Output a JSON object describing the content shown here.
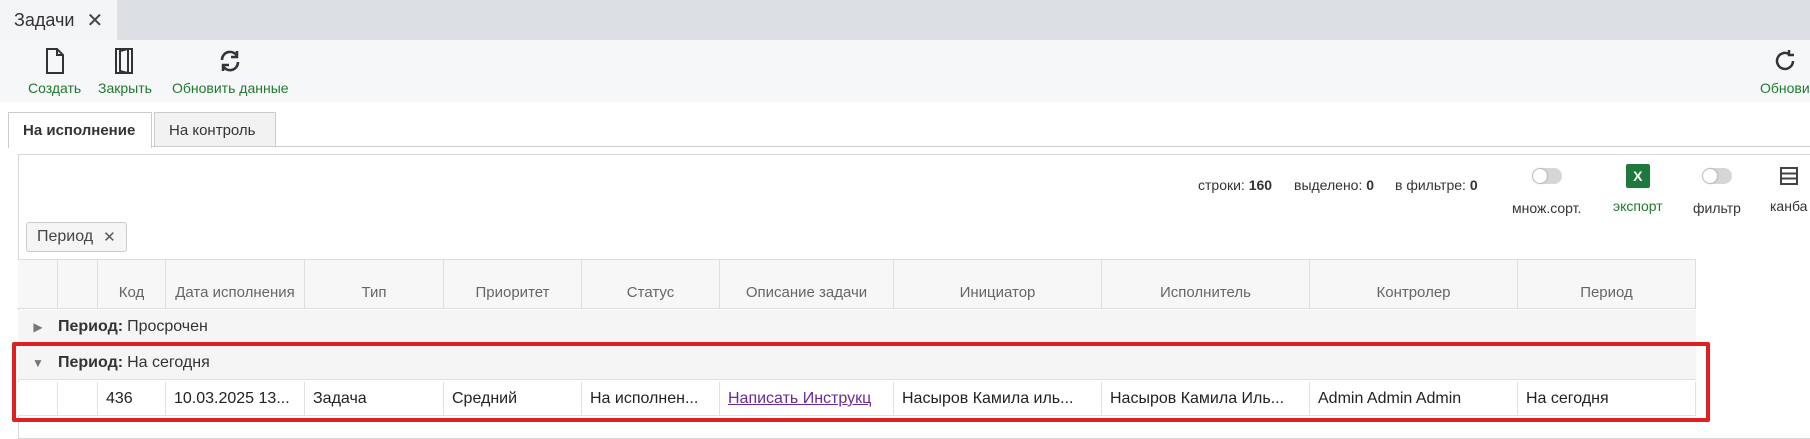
{
  "window_tab": {
    "title": "Задачи"
  },
  "toolbar": {
    "create": "Создать",
    "close": "Закрыть",
    "refresh_data": "Обновить данные",
    "refresh_right": "Обнови"
  },
  "subtabs": [
    "На исполнение",
    "На контроль"
  ],
  "stats": {
    "rows_label": "строки:",
    "rows": "160",
    "selected_label": "выделено:",
    "selected": "0",
    "filtered_label": "в фильтре:",
    "filtered": "0"
  },
  "controls": {
    "multisort": "множ.сорт.",
    "export": "экспорт",
    "export_icon": "X",
    "filter": "фильтр",
    "kanban": "канба"
  },
  "chip": {
    "label": "Период"
  },
  "columns": [
    "Код",
    "Дата исполнения",
    "Тип",
    "Приоритет",
    "Статус",
    "Описание задачи",
    "Инициатор",
    "Исполнитель",
    "Контролер",
    "Период"
  ],
  "groups": [
    {
      "key": "Период:",
      "value": "Просрочен"
    },
    {
      "key": "Период:",
      "value": "На сегодня"
    }
  ],
  "row": {
    "code": "436",
    "date": "10.03.2025 13...",
    "type": "Задача",
    "priority": "Средний",
    "status": "На исполнен...",
    "description": "Написать Инструкц",
    "initiator": "Насыров Камила иль...",
    "executor": "Насыров Камила Иль...",
    "controller": "Admin Admin Admin",
    "period": "На сегодня"
  },
  "colors": {
    "accent_green": "#1f7a2e",
    "highlight_red": "#e02020",
    "link_purple": "#6a2a9a"
  }
}
